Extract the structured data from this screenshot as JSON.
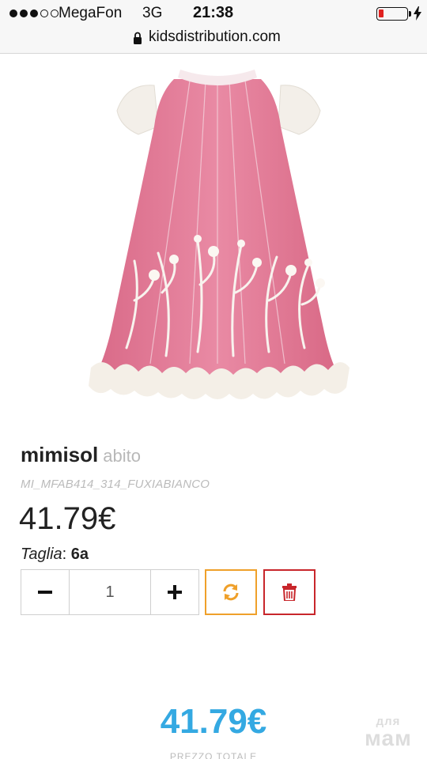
{
  "status_bar": {
    "carrier": "MegaFon",
    "network": "3G",
    "time": "21:38",
    "signal_bars_filled": 3,
    "signal_bars_total": 5,
    "battery_level_percent": 10,
    "battery_color": "#e0211f"
  },
  "browser": {
    "url": "kidsdistribution.com",
    "lock_icon": "lock-icon"
  },
  "product": {
    "image_alt": "dress-image",
    "brand": "mimisol",
    "category": "abito",
    "sku": "MI_MFAB414_314_FUXIABIANCO",
    "price": "41.79€",
    "size_label": "Taglia",
    "size_value": "6a"
  },
  "cart": {
    "minus_icon": "minus-icon",
    "quantity": "1",
    "plus_icon": "plus-icon",
    "refresh_icon": "refresh-icon",
    "refresh_color": "#efa02a",
    "delete_icon": "trash-icon",
    "delete_color": "#c8262b"
  },
  "summary": {
    "total": "41.79€",
    "total_label": "PREZZO TOTALE",
    "total_color": "#34a9e2"
  },
  "watermark": {
    "line1": "для",
    "line2": "мам"
  }
}
